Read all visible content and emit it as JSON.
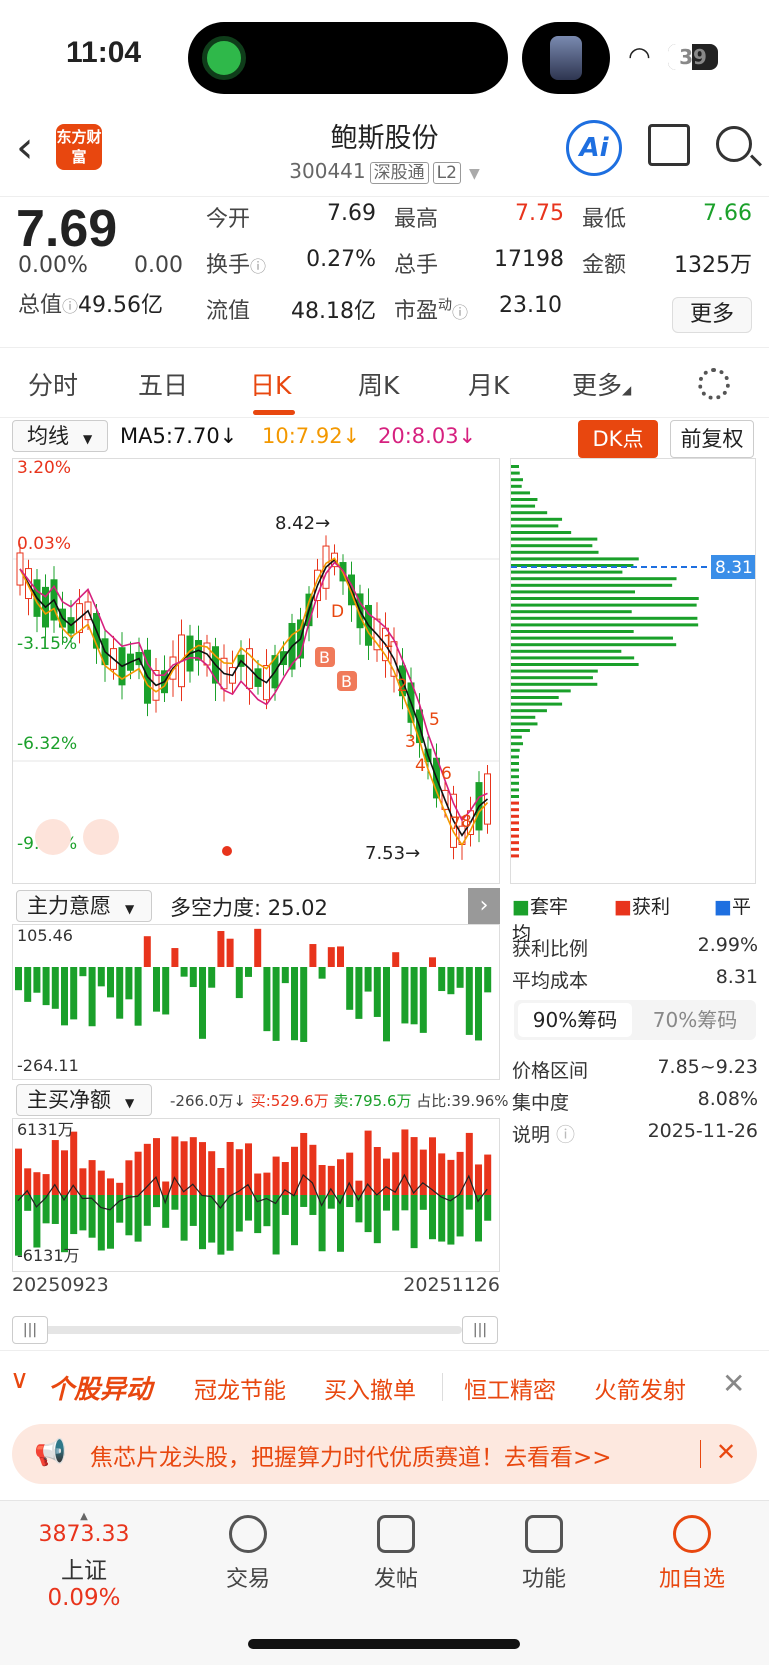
{
  "status_bar": {
    "time": "11:04",
    "battery": "39"
  },
  "nav": {
    "logo": "东方财富",
    "stock_name": "鲍斯股份",
    "code": "300441",
    "tag1": "深股通",
    "tag2": "L2",
    "ai": "Ai"
  },
  "quote": {
    "price": "7.69",
    "change_pct": "0.00%",
    "change": "0.00",
    "open_label": "今开",
    "open": "7.69",
    "high_label": "最高",
    "high": "7.75",
    "low_label": "最低",
    "low": "7.66",
    "turnover_label": "换手",
    "turnover": "0.27%",
    "volume_label": "总手",
    "volume": "17198",
    "amount_label": "金额",
    "amount": "1325万",
    "mcap_label": "总值",
    "mcap": "49.56亿",
    "float_label": "流值",
    "float": "48.18亿",
    "pe_label": "市盈",
    "pe_sup": "动",
    "pe": "23.10",
    "more": "更多"
  },
  "tabs": [
    "分时",
    "五日",
    "日K",
    "周K",
    "月K",
    "更多"
  ],
  "ma": {
    "selector": "均线",
    "ma5": "MA5:7.70↓",
    "ma10": "10:7.92↓",
    "ma20": "20:8.03↓",
    "dk": "DK点",
    "adjust": "前复权"
  },
  "kline": {
    "pct_labels": [
      "3.20%",
      "0.03%",
      "-3.15%",
      "-6.32%",
      "-9.49%"
    ],
    "high_marker": "8.42→",
    "low_marker": "7.53→",
    "signals": [
      "1",
      "2",
      "3",
      "4",
      "5",
      "6",
      "7",
      "8"
    ],
    "buy_label": "B",
    "sell_label": "D"
  },
  "chips": {
    "avg_label": "8.31",
    "legend": [
      "套牢",
      "获利",
      "平均"
    ],
    "profit_ratio_label": "获利比例",
    "profit_ratio": "2.99%",
    "avg_cost_label": "平均成本",
    "avg_cost": "8.31",
    "tab90": "90%筹码",
    "tab70": "70%筹码",
    "range_label": "价格区间",
    "range": "7.85~9.23",
    "concentration_label": "集中度",
    "concentration": "8.08%",
    "note_label": "说明",
    "date": "2025-11-26"
  },
  "indicator1": {
    "selector": "主力意愿",
    "text": "多空力度: 25.02",
    "max": "105.46",
    "min": "-264.11"
  },
  "indicator2": {
    "selector": "主买净额",
    "net": "-266.0万↓",
    "buy": "买:529.6万",
    "sell": "卖:795.6万",
    "ratio": "占比:39.96%",
    "max": "6131万",
    "min": "-6131万"
  },
  "dates": {
    "start": "20250923",
    "end": "20251126"
  },
  "alerts": {
    "title": "个股异动",
    "items": [
      "冠龙节能",
      "买入撤单",
      "恒工精密",
      "火箭发射"
    ]
  },
  "banner": {
    "text": "焦芯片龙头股，把握算力时代优质赛道！去看看>>"
  },
  "bottom": {
    "index_value": "3873.33",
    "index_name": "上证",
    "index_pct": "0.09%",
    "trade": "交易",
    "post": "发帖",
    "func": "功能",
    "add": "加自选"
  },
  "colors": {
    "up": "#e8341c",
    "down": "#1aa02a",
    "accent": "#e8470f",
    "ma5": "#111111",
    "ma10": "#f39800",
    "ma20": "#d6217f"
  }
}
